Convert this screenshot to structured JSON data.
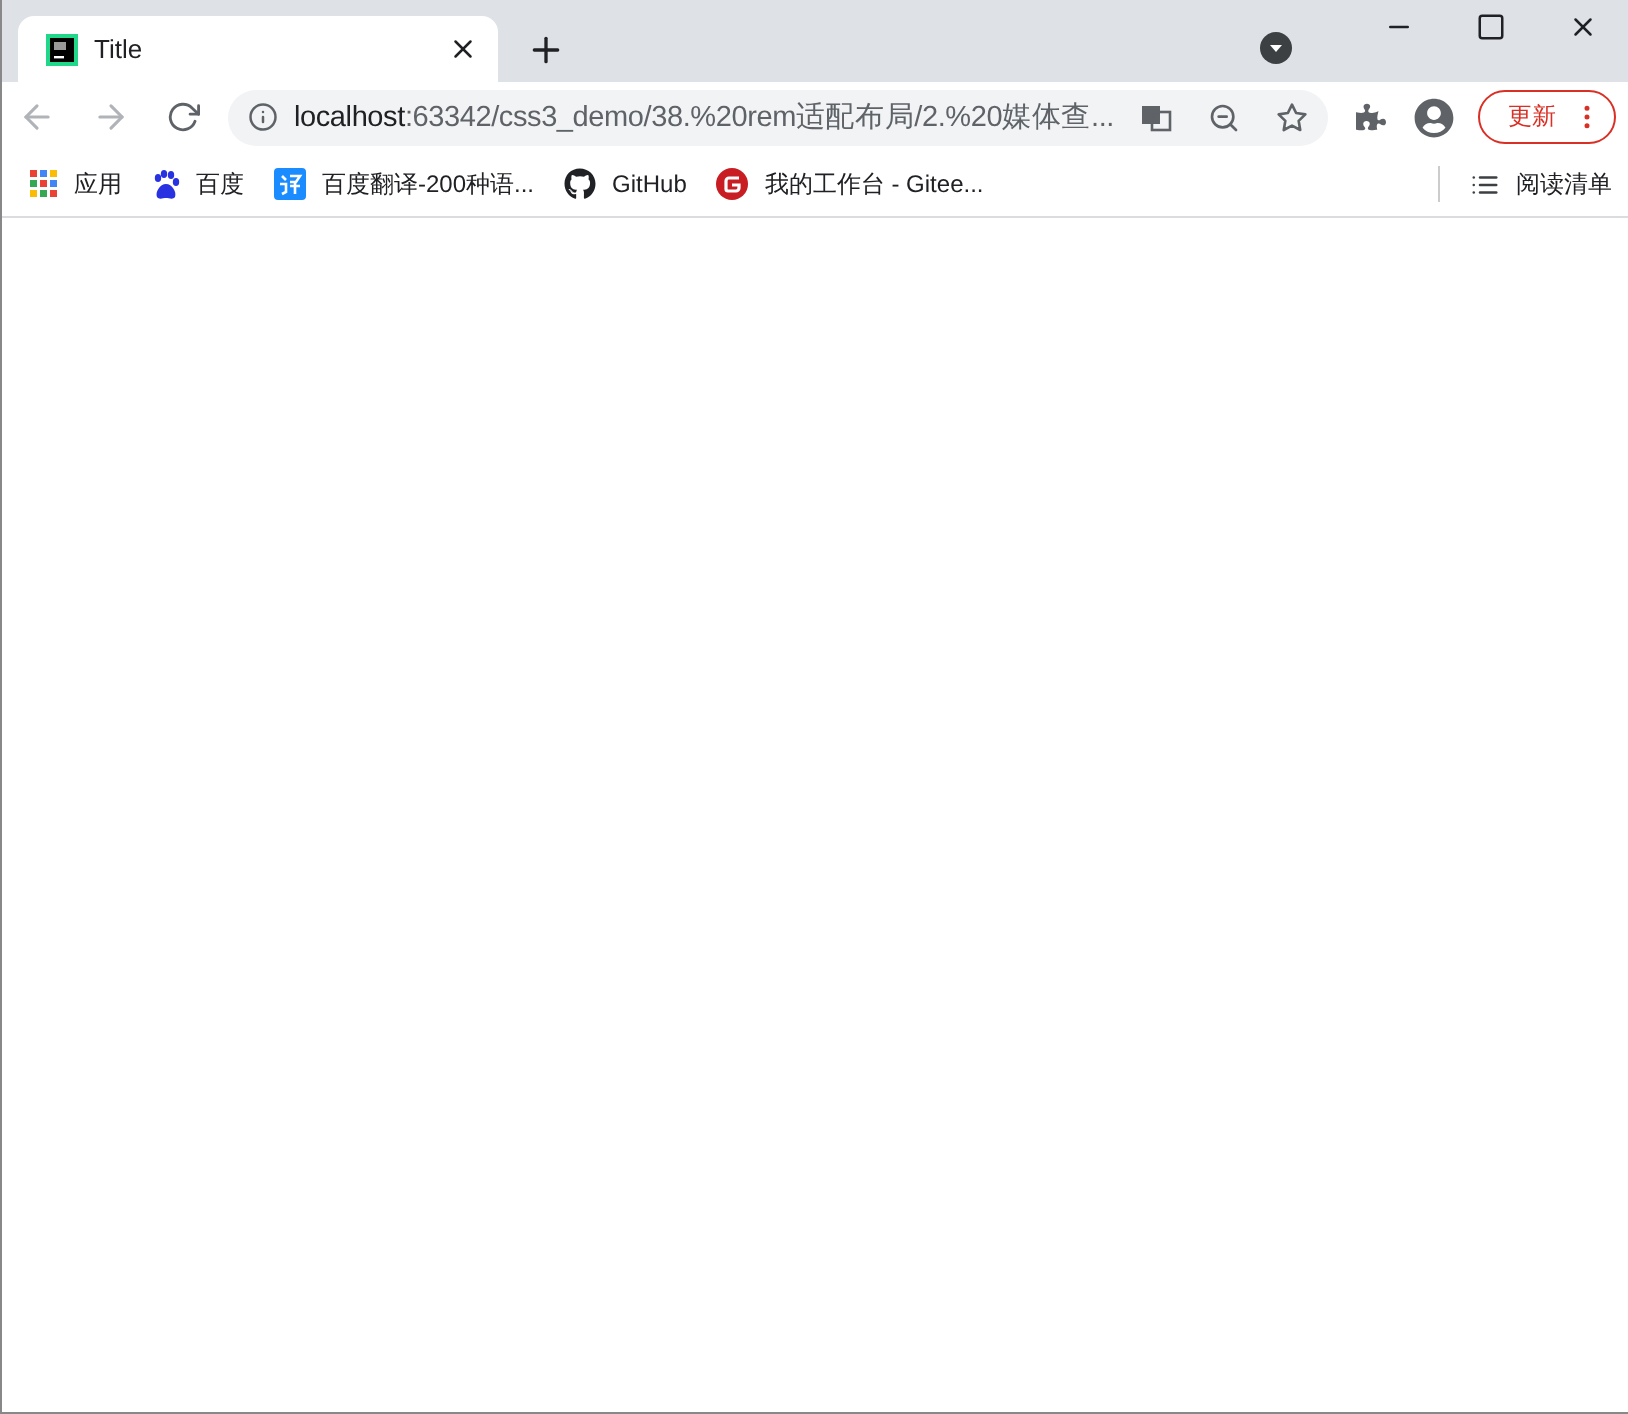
{
  "tabs": [
    {
      "title": "Title",
      "selected": true
    }
  ],
  "address_bar": {
    "host": "localhost",
    "path": ":63342/css3_demo/38.%20rem适配布局/2.%20媒体查..."
  },
  "update_button": {
    "label": "更新"
  },
  "bookmarks": [
    {
      "kind": "apps",
      "label": "应用"
    },
    {
      "kind": "paw",
      "label": "百度"
    },
    {
      "kind": "translate",
      "label": "百度翻译-200种语..."
    },
    {
      "kind": "github",
      "label": "GitHub"
    },
    {
      "kind": "gitee",
      "label": "我的工作台 - Gitee..."
    }
  ],
  "reading_list": {
    "label": "阅读清单"
  }
}
